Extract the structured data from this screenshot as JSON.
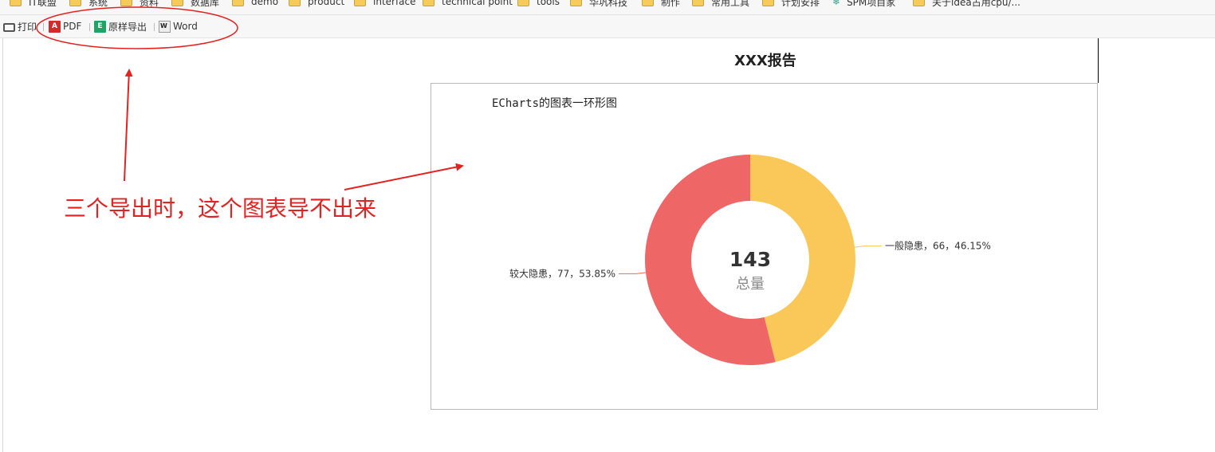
{
  "bookmarks": [
    {
      "label": "IT联盟"
    },
    {
      "label": "系统"
    },
    {
      "label": "资料"
    },
    {
      "label": "数据库"
    },
    {
      "label": "demo"
    },
    {
      "label": "product"
    },
    {
      "label": "interface"
    },
    {
      "label": "technical point"
    },
    {
      "label": "tools"
    },
    {
      "label": "华巩科技"
    },
    {
      "label": "制作"
    },
    {
      "label": "常用工具"
    },
    {
      "label": "计划安排"
    },
    {
      "label": "SPM项目家"
    },
    {
      "label": "关于idea占用cpu/..."
    }
  ],
  "toolbar": {
    "print_label": "打印",
    "pdf_label": "PDF",
    "original_export_label": "原样导出",
    "word_label": "Word"
  },
  "report": {
    "title": "XXX报告"
  },
  "annotation": {
    "note": "三个导出时，这个图表导不出来",
    "color": "#e32222"
  },
  "chart_data": {
    "type": "pie",
    "title": "ECharts的图表一环形图",
    "center_value": "143",
    "center_label": "总量",
    "slices": [
      {
        "name": "一般隐患",
        "value": 66,
        "percent": "46.15%",
        "color": "#f9c859",
        "label": "一般隐患，66，46.15%"
      },
      {
        "name": "较大隐患",
        "value": 77,
        "percent": "53.85%",
        "color": "#ee6666",
        "label": "较大隐患，77，53.85%"
      }
    ]
  }
}
